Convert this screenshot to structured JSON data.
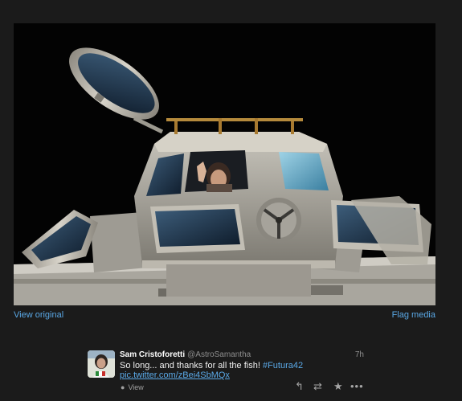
{
  "media": {
    "view_original_label": "View original",
    "flag_media_label": "Flag media"
  },
  "tweet": {
    "author_name": "Sam Cristoforetti",
    "author_handle": "@AstroSamantha",
    "timestamp": "7h",
    "text": "So long... and thanks for all the fish!",
    "hashtag": "#Futura42",
    "pic_link": "pic.twitter.com/zBei4SbMQx",
    "view_label": "View"
  },
  "icons": {
    "reply": "reply-icon",
    "retweet": "retweet-icon",
    "favorite": "star-icon",
    "more": "more-icon",
    "view": "comment-bubble-icon"
  },
  "colors": {
    "background": "#1b1b1b",
    "link": "#5aa8e6",
    "text": "#f0f0f0",
    "muted": "#8e8e8e"
  }
}
